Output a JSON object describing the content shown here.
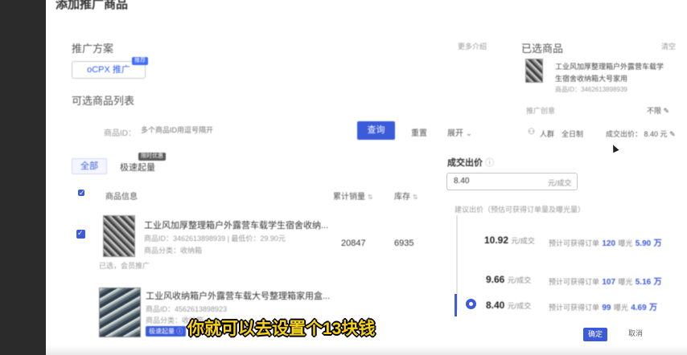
{
  "dialog": {
    "title": "添加推广商品"
  },
  "plan": {
    "section_title": "推广方案",
    "more_label": "更多介绍",
    "option_label": "oCPX 推广",
    "option_badge": "推荐"
  },
  "product_list": {
    "section_title": "可选商品列表",
    "search_label": "商品ID：",
    "search_placeholder": "多个商品ID用逗号隔开",
    "query_button": "查询",
    "reset_button": "重置",
    "filter_label": "展开",
    "tabs": [
      {
        "label": "全部",
        "active": true
      },
      {
        "label": "极速起量",
        "active": false,
        "badge": "限时优惠"
      }
    ],
    "columns": [
      "商品信息",
      "累计销量",
      "库存"
    ],
    "rows": [
      {
        "title": "工业风加厚整理箱户外露营车载学生宿舍收纳...",
        "meta1": "商品ID：3462613898939 | 最低价：29.90元",
        "meta2": "商品分类：收纳箱",
        "sales": "20847",
        "stock": "6935",
        "checked": true,
        "note": "已选，会员推广"
      },
      {
        "title": "工业风收纳箱户外露营车载大号整理箱家用盒...",
        "meta1": "商品ID：4562613898923",
        "meta2": "商品分类：收纳箱",
        "sales": "",
        "stock": "",
        "checked": false,
        "tag": "极速起量"
      }
    ]
  },
  "selected": {
    "section_title": "已选商品",
    "clear_label": "清空",
    "product_title_line1": "工业风加厚整理箱户外露营车载学",
    "product_title_line2": "生宿舍收纳箱大号家用",
    "product_id": "商品ID：3462613898939",
    "creative_label": "推广创意",
    "creative_value": "不限",
    "audience_label": "人群",
    "audience_value": "全日制",
    "bid_label": "成交出价：",
    "bid_value": "8.40 元"
  },
  "bid_panel": {
    "title": "成交出价",
    "input_value": "8.40",
    "input_unit": "元/成交",
    "hint": "建议出价（预估可获得订单量及曝光量）",
    "options": [
      {
        "price": "10.92",
        "unit": "元/成交",
        "orders_label": "预计可获得订单",
        "orders": "120",
        "exposure_label": "曝光",
        "exposure": "5.90",
        "exposure_unit": "万",
        "selected": false
      },
      {
        "price": "9.66",
        "unit": "元/成交",
        "orders_label": "预计可获得订单",
        "orders": "107",
        "exposure_label": "曝光",
        "exposure": "5.16",
        "exposure_unit": "万",
        "selected": false
      },
      {
        "price": "8.40",
        "unit": "元/成交",
        "orders_label": "预计可获得订单",
        "orders": "99",
        "exposure_label": "曝光",
        "exposure": "4.69",
        "exposure_unit": "万",
        "selected": true
      }
    ]
  },
  "footer": {
    "confirm_button": "确定",
    "cancel_button": "取消"
  },
  "subtitle": "你就可以去设置个13块钱",
  "colors": {
    "primary": "#3b5bdb",
    "subtitle": "#f7d21a"
  }
}
